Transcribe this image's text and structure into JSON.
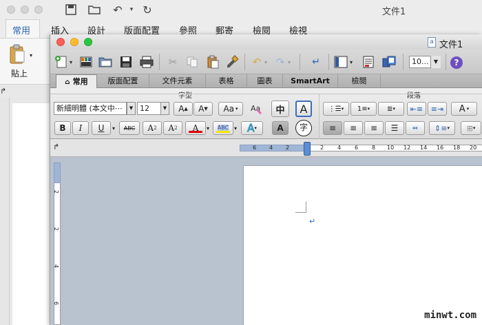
{
  "back_window": {
    "title": "文件1",
    "ribbon_tabs": [
      "常用",
      "插入",
      "設計",
      "版面配置",
      "參照",
      "郵寄",
      "檢閱",
      "檢視"
    ],
    "active_tab": "常用",
    "paste_label": "貼上"
  },
  "front_window": {
    "title": "文件1",
    "toolbar": {
      "zoom_value": "10...",
      "help_label": "?"
    },
    "ribbon_tabs": [
      "常用",
      "版面配置",
      "文件元素",
      "表格",
      "圖表",
      "SmartArt",
      "檢閱"
    ],
    "active_tab": "常用",
    "group_labels": {
      "font": "字型",
      "paragraph": "段落"
    },
    "font": {
      "name": "新細明體 (本文中⋯",
      "size": "12"
    },
    "format_buttons": {
      "bold": "B",
      "italic": "I",
      "underline": "U",
      "strikethrough": "ABC",
      "superscript": "A",
      "subscript": "A",
      "phonetic_label": "中",
      "highlight_label": "ABC",
      "char_border": "A",
      "enclose_char": "字",
      "grow_font": "A",
      "shrink_font": "A",
      "change_case": "Aa"
    },
    "ruler_h_numbers": [
      "6",
      "4",
      "2",
      "2",
      "4",
      "6",
      "8",
      "10",
      "12",
      "14",
      "16",
      "18",
      "20"
    ],
    "ruler_v_numbers": [
      "2",
      "2",
      "4",
      "6"
    ],
    "colors": {
      "accent_blue": "#2b65b4",
      "font_color_bar": "#e00000",
      "highlight_bar": "#f2e600",
      "doc_background": "#b9c2cf"
    }
  },
  "watermark": "minwt.com"
}
